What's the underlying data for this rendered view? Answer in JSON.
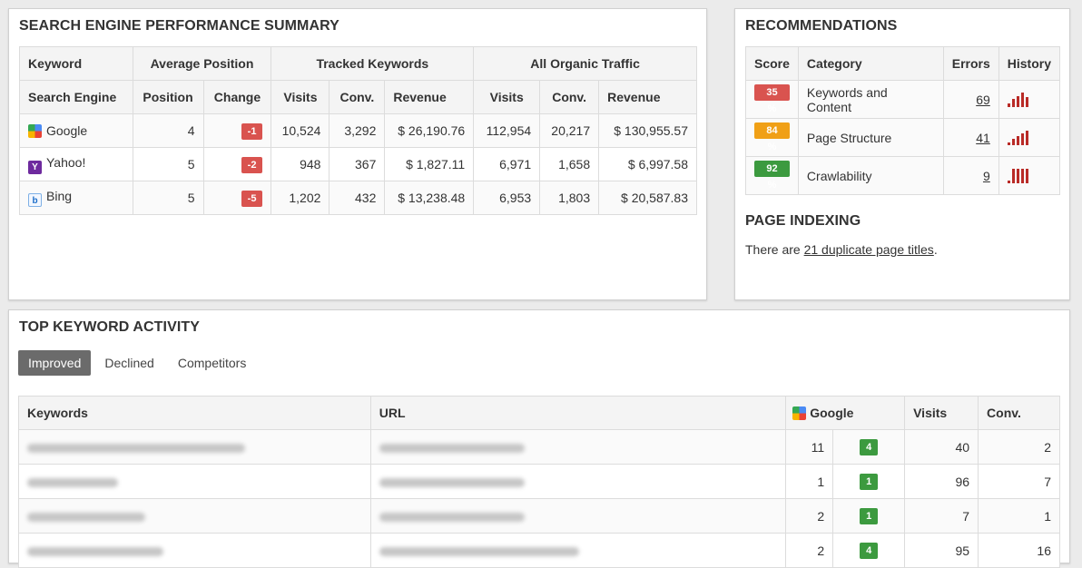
{
  "perf": {
    "title": "SEARCH ENGINE PERFORMANCE SUMMARY",
    "group_headers": [
      "Keyword",
      "Average Position",
      "Tracked Keywords",
      "All Organic Traffic"
    ],
    "col_headers": [
      "Search Engine",
      "Position",
      "Change",
      "Visits",
      "Conv.",
      "Revenue",
      "Visits",
      "Conv.",
      "Revenue"
    ],
    "rows": [
      {
        "engine": "Google",
        "icon": "google-icon",
        "position": "4",
        "change": "-1",
        "visits": "10,524",
        "conv": "3,292",
        "revenue": "$ 26,190.76",
        "all_visits": "112,954",
        "all_conv": "20,217",
        "all_revenue": "$ 130,955.57"
      },
      {
        "engine": "Yahoo!",
        "icon": "yahoo-icon",
        "position": "5",
        "change": "-2",
        "visits": "948",
        "conv": "367",
        "revenue": "$ 1,827.11",
        "all_visits": "6,971",
        "all_conv": "1,658",
        "all_revenue": "$ 6,997.58"
      },
      {
        "engine": "Bing",
        "icon": "bing-icon",
        "position": "5",
        "change": "-5",
        "visits": "1,202",
        "conv": "432",
        "revenue": "$ 13,238.48",
        "all_visits": "6,953",
        "all_conv": "1,803",
        "all_revenue": "$ 20,587.83"
      }
    ]
  },
  "recs": {
    "title": "RECOMMENDATIONS",
    "headers": [
      "Score",
      "Category",
      "Errors",
      "History"
    ],
    "rows": [
      {
        "score": "35 %",
        "score_color": "#d9534f",
        "category": "Keywords and Content",
        "errors": "69",
        "history": [
          2,
          5,
          7,
          9,
          6
        ]
      },
      {
        "score": "84 %",
        "score_color": "#f0a016",
        "category": "Page Structure",
        "errors": "41",
        "history": [
          2,
          5,
          7,
          9,
          11
        ]
      },
      {
        "score": "92 %",
        "score_color": "#3c9a3f",
        "category": "Crawlability",
        "errors": "9",
        "history": [
          2,
          11,
          11,
          11,
          11
        ]
      }
    ]
  },
  "indexing": {
    "title": "PAGE INDEXING",
    "text_before": "There are ",
    "link": "21 duplicate page titles",
    "text_after": "."
  },
  "activity": {
    "title": "TOP KEYWORD ACTIVITY",
    "tabs": [
      "Improved",
      "Declined",
      "Competitors"
    ],
    "active_tab": "Improved",
    "headers": [
      "Keywords",
      "URL",
      "Google",
      "Visits",
      "Conv."
    ],
    "rows": [
      {
        "position": "11",
        "change": "4",
        "visits": "40",
        "conv": "2"
      },
      {
        "position": "1",
        "change": "1",
        "visits": "96",
        "conv": "7"
      },
      {
        "position": "2",
        "change": "1",
        "visits": "7",
        "conv": "1"
      },
      {
        "position": "2",
        "change": "4",
        "visits": "95",
        "conv": "16"
      }
    ]
  },
  "colors": {
    "negative": "#d9534f",
    "positive": "#3c9a3f",
    "warning": "#f0a016",
    "history_bar": "#b92b27"
  }
}
